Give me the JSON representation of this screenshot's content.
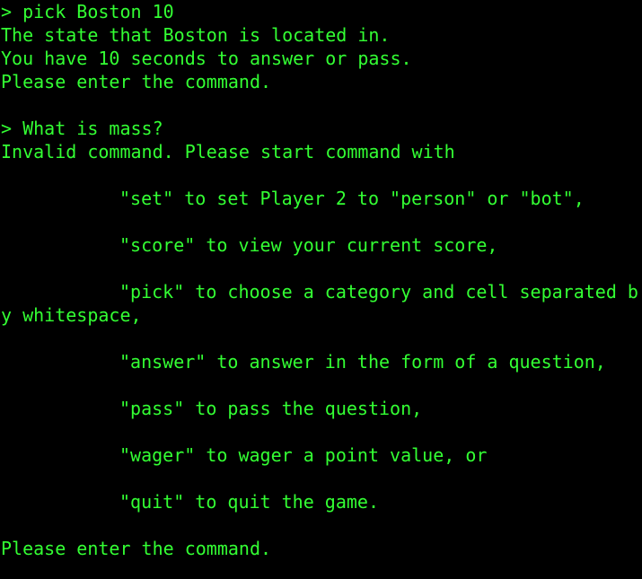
{
  "terminal": {
    "fg_color": "#33ff33",
    "bg_color": "#000000",
    "lines": {
      "l1": "> pick Boston 10",
      "l2": "The state that Boston is located in.",
      "l3": "You have 10 seconds to answer or pass.",
      "l4": "Please enter the command.",
      "l6": "> What is mass?",
      "l7": "Invalid command. Please start command with",
      "l9": "\"set\" to set Player 2 to \"person\" or \"bot\",",
      "l11": "\"score\" to view your current score,",
      "l13": "\"pick\" to choose a category and cell separated b",
      "l14": "y whitespace,",
      "l16": "\"answer\" to answer in the form of a question,",
      "l18": "\"pass\" to pass the question,",
      "l20": "\"wager\" to wager a point value, or",
      "l22": "\"quit\" to quit the game.",
      "l24": "Please enter the command."
    }
  }
}
